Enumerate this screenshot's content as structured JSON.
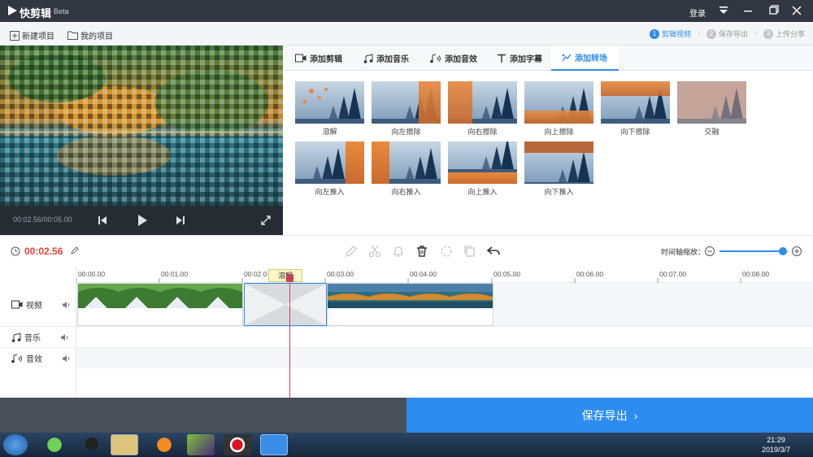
{
  "app": {
    "title": "快剪辑",
    "badge": "Beta",
    "login": "登录"
  },
  "projectbar": {
    "new_project": "新建项目",
    "my_projects": "我的项目",
    "steps": [
      {
        "num": "1",
        "label": "剪辑视频",
        "active": true
      },
      {
        "num": "2",
        "label": "保存导出",
        "active": false
      },
      {
        "num": "3",
        "label": "上传分享",
        "active": false
      }
    ]
  },
  "preview": {
    "time": "00:02.56/00:05.00"
  },
  "tabs": [
    {
      "label": "添加剪辑",
      "icon": "video-icon",
      "active": false
    },
    {
      "label": "添加音乐",
      "icon": "music-icon",
      "active": false
    },
    {
      "label": "添加音效",
      "icon": "sound-effect-icon",
      "active": false
    },
    {
      "label": "添加字幕",
      "icon": "text-icon",
      "active": false
    },
    {
      "label": "添加转场",
      "icon": "transition-icon",
      "active": true
    }
  ],
  "transitions": [
    {
      "label": "溶解",
      "style": "dissolve"
    },
    {
      "label": "向左擦除",
      "style": "wipe-left"
    },
    {
      "label": "向右擦除",
      "style": "wipe-right"
    },
    {
      "label": "向上擦除",
      "style": "wipe-up"
    },
    {
      "label": "向下擦除",
      "style": "wipe-down"
    },
    {
      "label": "交融",
      "style": "blend"
    },
    {
      "label": "向左推入",
      "style": "push-left"
    },
    {
      "label": "向右推入",
      "style": "push-right"
    },
    {
      "label": "向上推入",
      "style": "push-up"
    },
    {
      "label": "向下推入",
      "style": "push-down"
    }
  ],
  "toolbar": {
    "current_time": "00:02.56",
    "zoom_label": "时间轴缩放：",
    "zoom_level": 0.92
  },
  "timeline": {
    "ticks": [
      "00:00.00",
      "00:01.00",
      "00:02.0",
      "00:03.00",
      "00:04.00",
      "00:05.00",
      "00:06.00",
      "00:07.00",
      "00:08.00"
    ],
    "playhead_tooltip": "溶解",
    "tracks": [
      {
        "label": "视频",
        "icon": "video-icon"
      },
      {
        "label": "音乐",
        "icon": "music-icon"
      },
      {
        "label": "音效",
        "icon": "sound-effect-icon"
      }
    ]
  },
  "export": {
    "label": "保存导出"
  },
  "taskbar": {
    "time": "21:29",
    "date": "2019/3/7"
  },
  "colors": {
    "accent": "#2d8cf0",
    "time_red": "#e0463a",
    "titlebar": "#303740"
  }
}
